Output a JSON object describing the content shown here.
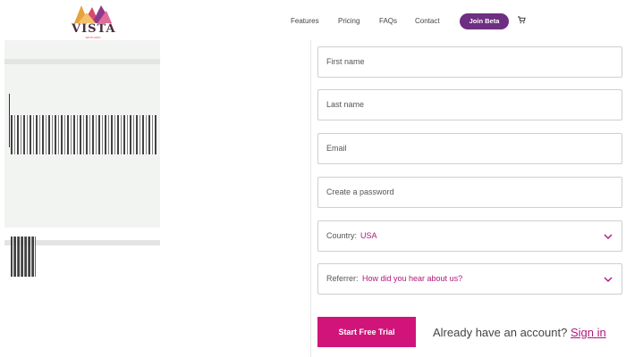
{
  "brand": {
    "name": "VISTA",
    "tagline": "WP PLUGIN"
  },
  "nav": {
    "items": [
      "Features",
      "Pricing",
      "FAQs",
      "Contact"
    ],
    "beta_label": "Join Beta"
  },
  "form": {
    "first_name": {
      "placeholder": "First name"
    },
    "last_name": {
      "placeholder": "Last name"
    },
    "email": {
      "placeholder": "Email"
    },
    "password": {
      "placeholder": "Create a password"
    },
    "country": {
      "label": "Country:",
      "value": "USA"
    },
    "referrer": {
      "label": "Referrer:",
      "value": "How did you hear about us?"
    },
    "submit_label": "Start Free Trial",
    "account_prompt": "Already have an account?",
    "signin_label": "Sign in"
  },
  "colors": {
    "accent": "#d1147a",
    "brand_purple": "#6e2e81",
    "link": "#b0177a"
  },
  "icons": {
    "cart": "cart-icon",
    "chevron": "chevron-down-icon"
  }
}
